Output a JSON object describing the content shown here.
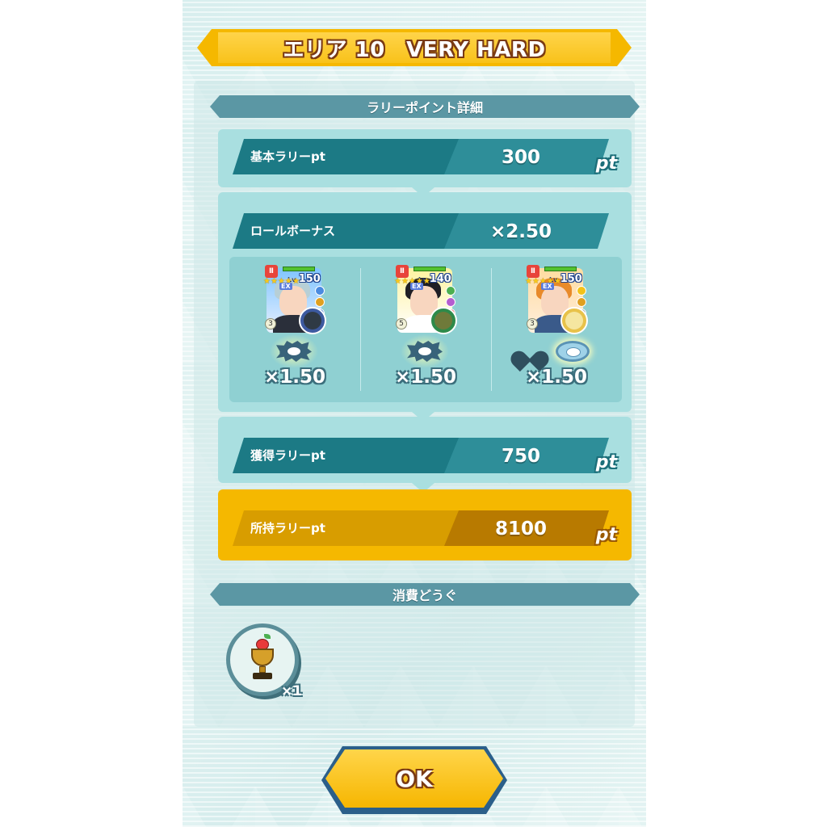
{
  "title": "エリア 10　VERY HARD",
  "rally_section_header": "ラリーポイント詳細",
  "base": {
    "label": "基本ラリーpt",
    "value": "300",
    "unit": "pt"
  },
  "role_bonus": {
    "label": "ロールボーナス",
    "value": "×2.50"
  },
  "units": [
    {
      "level": "150",
      "rarity": "EX",
      "potential": "3",
      "role": "strike",
      "multiplier": "×1.50"
    },
    {
      "level": "140",
      "rarity": "EX",
      "potential": "5",
      "role": "strike",
      "multiplier": "×1.50"
    },
    {
      "level": "150",
      "rarity": "EX",
      "potential": "3",
      "role": "strike",
      "multiplier": "×1.50"
    }
  ],
  "earned": {
    "label": "獲得ラリーpt",
    "value": "750",
    "unit": "pt"
  },
  "owned": {
    "label": "所持ラリーpt",
    "value": "8100",
    "unit": "pt"
  },
  "items_section_header": "消費どうぐ",
  "item": {
    "icon": "trophy-icon",
    "count": "×1"
  },
  "ok_button": "OK",
  "colors": {
    "banner": "#f5b800",
    "teal_bar": "#1c7a85",
    "panel": "#a9dfe0",
    "gold_panel": "#f5b800"
  }
}
